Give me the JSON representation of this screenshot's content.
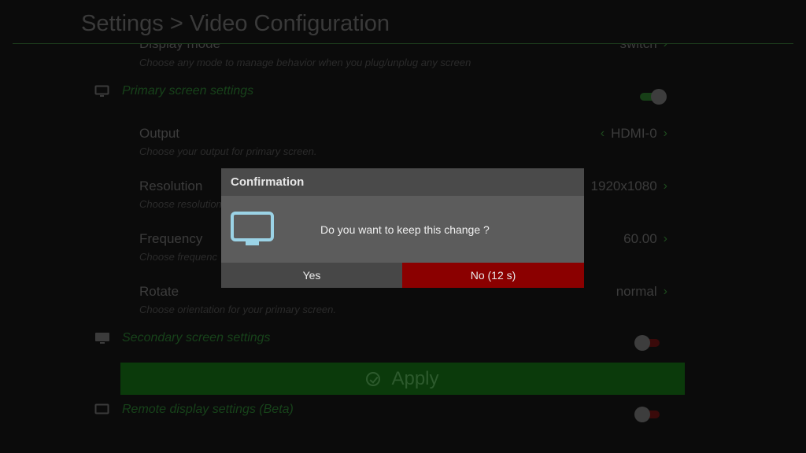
{
  "header": {
    "title": "Settings > Video Configuration"
  },
  "rows": {
    "display_mode": {
      "title": "Display mode",
      "subtitle": "Choose any mode to manage behavior when you plug/unplug any screen",
      "value": "switch"
    },
    "output": {
      "title": "Output",
      "subtitle": "Choose your output for primary screen.",
      "value": "HDMI-0"
    },
    "resolution": {
      "title": "Resolution",
      "subtitle": "Choose resolution",
      "value": "1920x1080"
    },
    "frequency": {
      "title": "Frequency",
      "subtitle": "Choose frequenc",
      "value": "60.00"
    },
    "rotate": {
      "title": "Rotate",
      "subtitle": "Choose orientation for your primary screen.",
      "value": "normal"
    }
  },
  "sections": {
    "primary": {
      "label": "Primary screen settings",
      "enabled": true
    },
    "secondary": {
      "label": "Secondary screen settings",
      "enabled": false
    },
    "remote": {
      "label": "Remote display settings (Beta)",
      "enabled": false
    }
  },
  "apply": {
    "label": "Apply"
  },
  "dialog": {
    "title": "Confirmation",
    "message": "Do you want to keep this change ?",
    "yes_label": "Yes",
    "no_label": "No (12 s)",
    "icon": "monitor-icon"
  },
  "colors": {
    "accent_green": "#0b3a0b",
    "toggle_on": "#2e6b2e",
    "toggle_off_track": "#3a0a0a",
    "no_button": "#8b0000"
  },
  "icons": {
    "chevron": "chevron-icon",
    "section": "monitor-icon",
    "apply": "check-circle-icon"
  }
}
